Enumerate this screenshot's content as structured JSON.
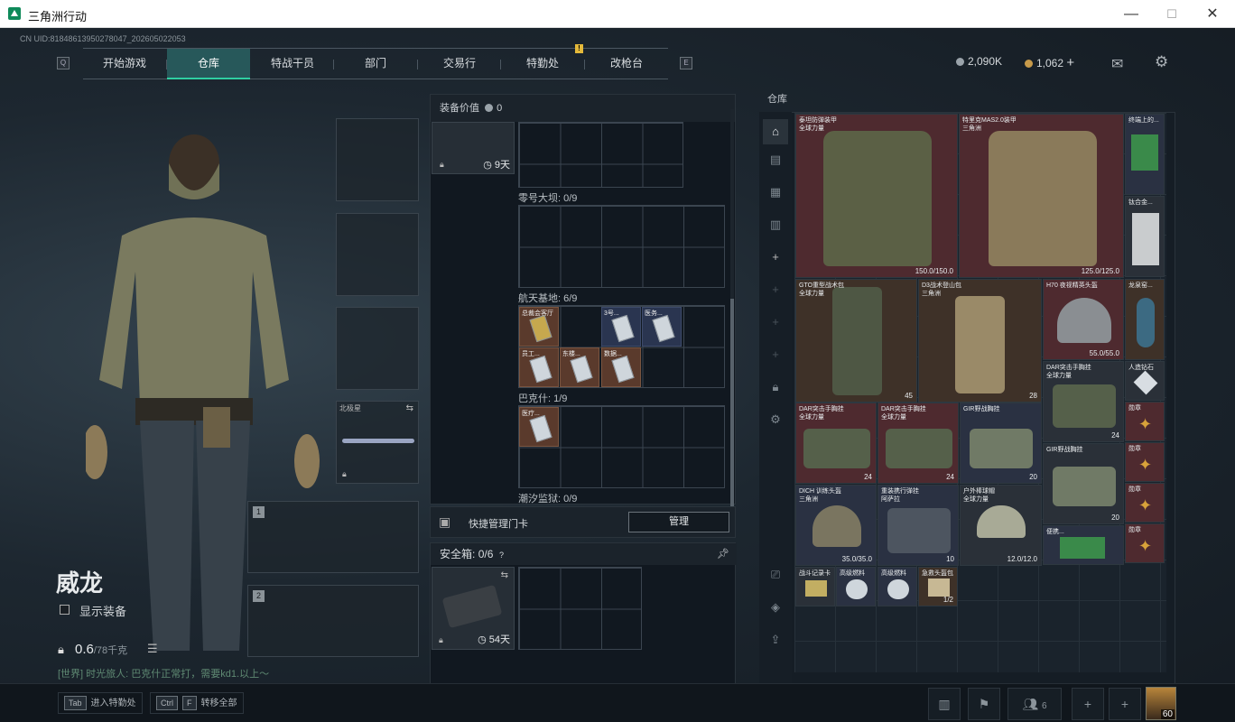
{
  "window": {
    "title": "三角洲行动",
    "min": "—",
    "max": "☐",
    "close": "✕"
  },
  "uid": "CN UID:8184861395027804​7_202605022053",
  "nav": {
    "left_key": "Q",
    "right_key": "E",
    "alert": "!",
    "tabs": [
      "开始游戏",
      "仓库",
      "特战干员",
      "部门",
      "交易行",
      "特勤处",
      "改枪台"
    ]
  },
  "currency": {
    "silver": "2,090K",
    "gold": "1,062",
    "plus": "+"
  },
  "character": {
    "name": "威龙",
    "show_equip": "显示装备",
    "weight": "0.6",
    "weight_max": "/78千克",
    "chat": "[世界] 时光旅人: 巴克什正常打，需要kd1.以上～"
  },
  "equip": {
    "gun_name": "北极星",
    "slot1": "1",
    "slot2": "2"
  },
  "mid": {
    "value_label": "装备价值",
    "value": "0",
    "timer1": "9天",
    "grids": [
      "零号大坝: 0/9",
      "航天基地: 6/9",
      "巴克什: 1/9",
      "潮汐监狱: 0/9"
    ],
    "cards": [
      "总裁会客厅",
      "3号...",
      "医务...",
      "员工...",
      "东楼...",
      "数据...",
      "医疗..."
    ],
    "quick_label": "快捷管理门卡",
    "quick_btn": "管理",
    "safe_label": "安全箱:",
    "safe_val": "0/6",
    "safe_q": "?",
    "safe_timer": "54天"
  },
  "warehouse": {
    "title": "仓库",
    "items": [
      {
        "name": "泰坦防弹装甲",
        "sub": "全球力量",
        "dur": "150.0/150.0"
      },
      {
        "name": "特里克MAS2.0装甲",
        "sub": "三角洲",
        "dur": "125.0/125.0"
      },
      {
        "name": "终端上的...",
        "sub": "",
        "dur": ""
      },
      {
        "name": "钛合金...",
        "sub": "",
        "dur": ""
      },
      {
        "name": "GTO重型战术包",
        "sub": "全球力量",
        "dur": "45"
      },
      {
        "name": "D3战术登山包",
        "sub": "三角洲",
        "dur": "28"
      },
      {
        "name": "H70 夜视精英头盔",
        "sub": "",
        "dur": "55.0/55.0"
      },
      {
        "name": "龙泉窑...",
        "sub": "",
        "dur": ""
      },
      {
        "name": "DAR突击手胸挂",
        "sub": "全球力量",
        "dur": "24"
      },
      {
        "name": "DAR突击手胸挂",
        "sub": "全球力量",
        "dur": "24"
      },
      {
        "name": "DAR突击手胸挂",
        "sub": "全球力量",
        "dur": "24"
      },
      {
        "name": "GIR野战胸挂",
        "sub": "",
        "dur": "20"
      },
      {
        "name": "GIR野战胸挂",
        "sub": "",
        "dur": "20"
      },
      {
        "name": "人造钻石",
        "sub": "",
        "dur": ""
      },
      {
        "name": "勋章",
        "sub": "",
        "dur": ""
      },
      {
        "name": "DICH 训练头盔",
        "sub": "三角洲",
        "dur": "35.0/35.0"
      },
      {
        "name": "重装携行弹挂",
        "sub": "阿萨拉",
        "dur": "10"
      },
      {
        "name": "户外棒球帽",
        "sub": "全球力量",
        "dur": "12.0/12.0"
      },
      {
        "name": "便携...",
        "sub": "",
        "dur": ""
      },
      {
        "name": "战斗记录卡",
        "sub": "",
        "dur": ""
      },
      {
        "name": "高级燃料",
        "sub": "",
        "dur": ""
      },
      {
        "name": "高级燃料",
        "sub": "",
        "dur": ""
      },
      {
        "name": "急救头盔包",
        "sub": "",
        "dur": "1/2"
      }
    ]
  },
  "bottom": {
    "tab_key": "Tab",
    "tab_label": "进入特勤处",
    "ctrl_key": "Ctrl",
    "f_key": "F",
    "ctrl_label": "转移全部",
    "friends": "6",
    "level": "60"
  }
}
